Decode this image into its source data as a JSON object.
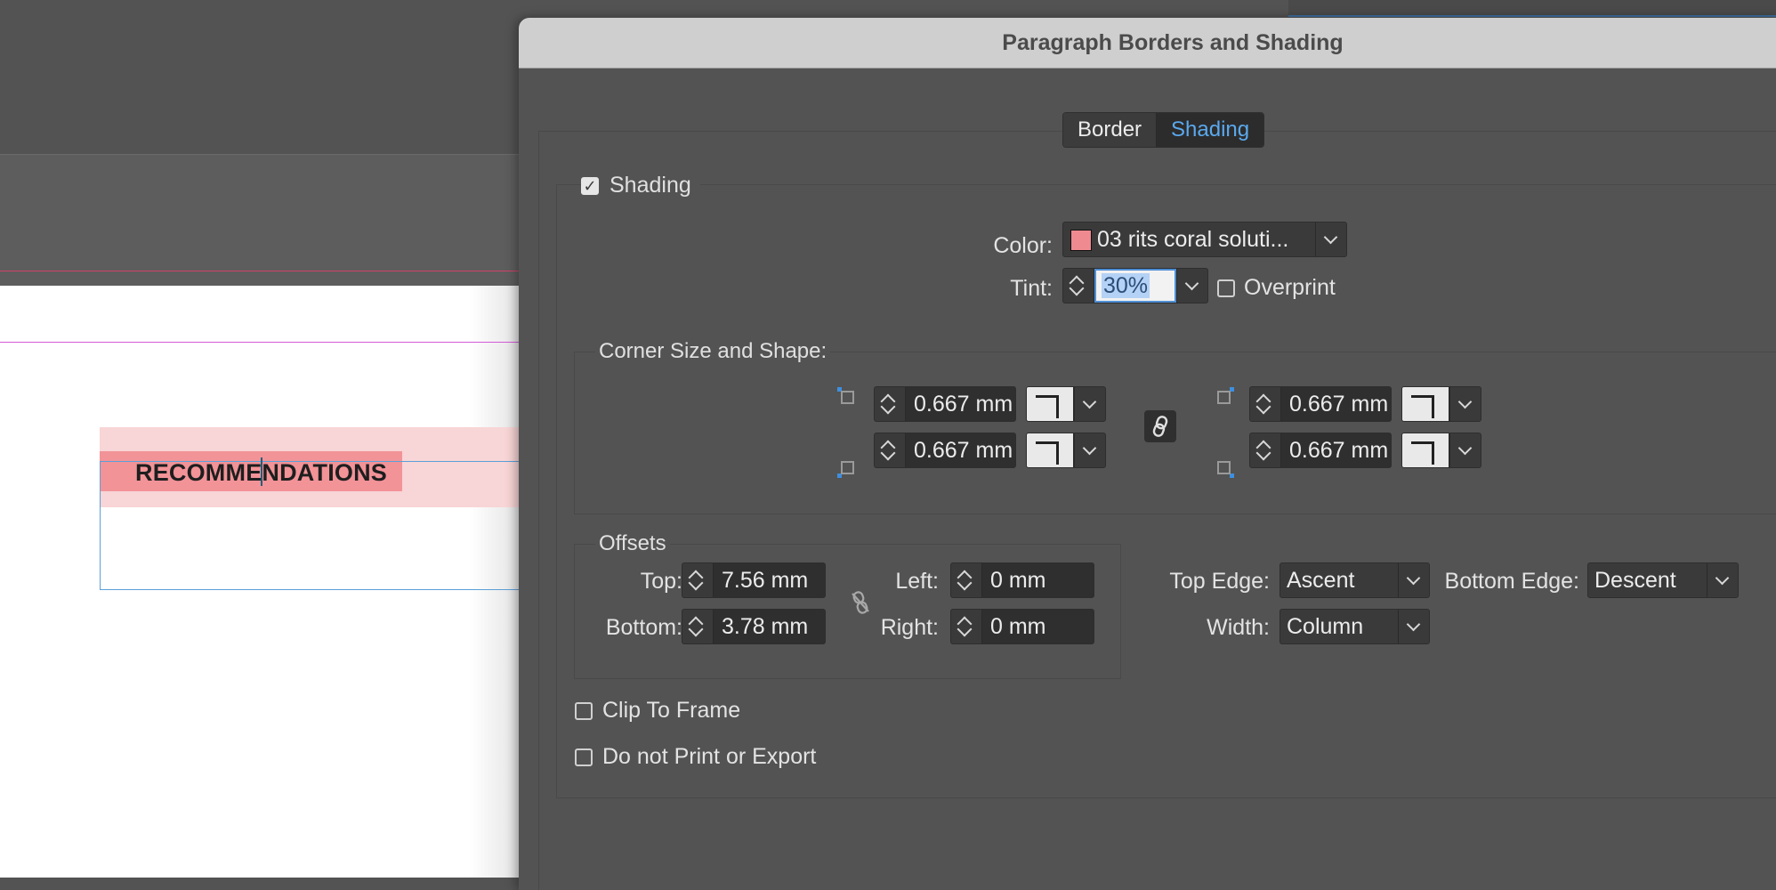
{
  "document": {
    "paragraph_text": "RECOMMENDATIONS",
    "text_before_caret": "RECOMME",
    "text_after_caret": "NDATIONS"
  },
  "dialog": {
    "title": "Paragraph Borders and Shading",
    "tabs": [
      {
        "label": "Border",
        "active": false
      },
      {
        "label": "Shading",
        "active": true
      }
    ],
    "shading": {
      "enabled": true,
      "label": "Shading",
      "color_label": "Color:",
      "color_value": "03 rits coral soluti...",
      "color_swatch": "#ee8a90",
      "tint_label": "Tint:",
      "tint_value": "30%",
      "overprint_label": "Overprint",
      "overprint_checked": false
    },
    "corners": {
      "group_label": "Corner Size and Shape:",
      "top_left": "0.667 mm",
      "top_right": "0.667 mm",
      "bottom_left": "0.667 mm",
      "bottom_right": "0.667 mm",
      "linked": true
    },
    "offsets": {
      "group_label": "Offsets",
      "top_label": "Top:",
      "top_value": "7.56 mm",
      "bottom_label": "Bottom:",
      "bottom_value": "3.78 mm",
      "left_label": "Left:",
      "left_value": "0 mm",
      "right_label": "Right:",
      "right_value": "0 mm",
      "linked": false
    },
    "edges": {
      "top_edge_label": "Top Edge:",
      "top_edge_value": "Ascent",
      "bottom_edge_label": "Bottom Edge:",
      "bottom_edge_value": "Descent",
      "width_label": "Width:",
      "width_value": "Column"
    },
    "options": {
      "clip_to_frame_label": "Clip To Frame",
      "clip_to_frame_checked": false,
      "do_not_print_label": "Do not Print or Export",
      "do_not_print_checked": false
    }
  },
  "colors": {
    "accent": "#5aa9ee",
    "shading_light": "#f8d5d6",
    "shading_strong": "#f29398"
  }
}
